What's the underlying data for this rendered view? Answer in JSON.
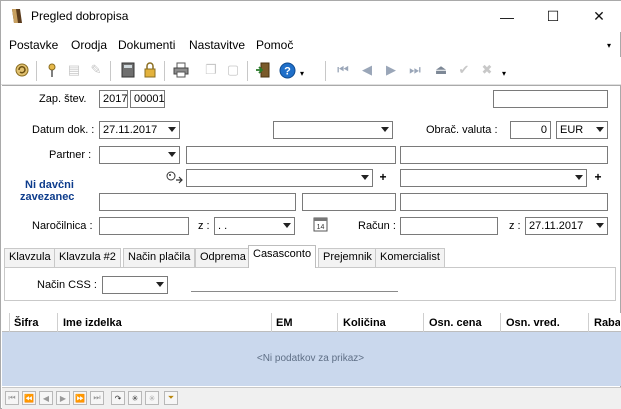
{
  "window": {
    "title": "Pregled dobropisa",
    "minimize": "—",
    "maximize": "☐",
    "close": "✕"
  },
  "menu": [
    "Postavke",
    "Orodja",
    "Dokumenti",
    "Nastavitve",
    "Pomoč"
  ],
  "menu_more": "▾",
  "toolbar": {
    "icons": [
      "refresh-icon",
      "pin-icon",
      "save-icon",
      "eraser-icon",
      "calculator-icon",
      "lock-icon",
      "print-icon",
      "copy-icon",
      "paste-icon",
      "exit-door-icon",
      "help-icon",
      "first-record-icon",
      "prev-record-icon",
      "next-record-icon",
      "last-record-icon",
      "eject-icon",
      "confirm-icon",
      "cancel-icon"
    ],
    "more": "▾"
  },
  "form": {
    "zap_label": "Zap. štev.",
    "zap_year": "2017",
    "zap_num": "00001",
    "datum_label": "Datum dok. :",
    "datum_value": "27.11.2017",
    "obrac_label": "Obrač. valuta :",
    "obrac_amount": "0",
    "obrac_currency": "EUR",
    "partner_label": "Partner :",
    "tax_status_line1": "Ni davčni",
    "tax_status_line2": "zavezanec",
    "narocilnica_label": "Naročilnica :",
    "z_label": "z :",
    "z_value": ". .",
    "calendar_day": "14",
    "racun_label": "Račun :",
    "z2_label": "z :",
    "z2_value": "27.11.2017"
  },
  "tabs": [
    "Klavzula",
    "Klavzula #2",
    "Način plačila",
    "Odprema",
    "Casasconto",
    "Prejemnik",
    "Komercialist"
  ],
  "active_tab": "Casasconto",
  "tab_panel": {
    "css_label": "Način CSS :"
  },
  "grid": {
    "columns": [
      "Šifra",
      "Ime izdelka",
      "EM",
      "Količina",
      "Osn. cena",
      "Osn. vred.",
      "Rabat"
    ],
    "empty_text": "<Ni podatkov za prikaz>"
  },
  "navigator": [
    "first-icon",
    "prev-page-icon",
    "prev-icon",
    "next-icon",
    "next-page-icon",
    "last-icon",
    "refresh-icon",
    "star-icon",
    "star-disabled-icon",
    "filter-icon"
  ]
}
